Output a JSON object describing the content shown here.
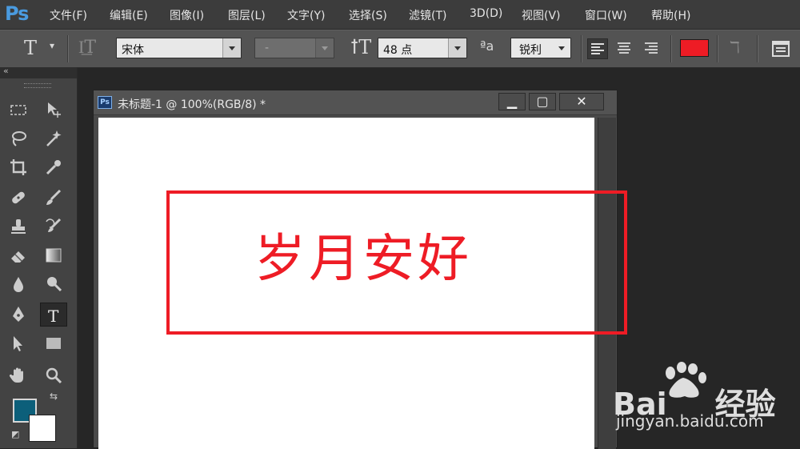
{
  "app": {
    "logo": "Ps"
  },
  "menu": [
    "文件(F)",
    "编辑(E)",
    "图像(I)",
    "图层(L)",
    "文字(Y)",
    "选择(S)",
    "滤镜(T)",
    "3D(D)",
    "视图(V)",
    "窗口(W)",
    "帮助(H)"
  ],
  "options": {
    "font_family": "宋体",
    "font_style": "-",
    "font_size": "48 点",
    "antialias": "锐利",
    "text_color": "#ee1c25"
  },
  "toolbox": {
    "foreground_color": "#0c5f7a",
    "background_color": "#ffffff"
  },
  "document": {
    "title": "未标题-1 @ 100%(RGB/8) *",
    "canvas_text": "岁月安好",
    "text_color": "#ee1c25",
    "minimize": "▁",
    "maximize": "▢",
    "close": "✕"
  },
  "watermark": {
    "brand": "Bai",
    "brand_suffix": "经验",
    "url": "jingyan.baidu.com"
  }
}
